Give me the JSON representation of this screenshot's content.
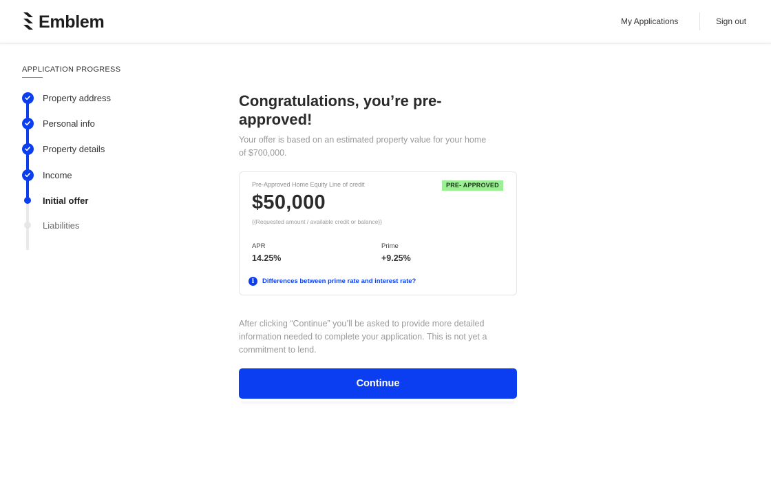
{
  "header": {
    "brand": "Emblem",
    "nav": {
      "my_applications": "My Applications",
      "sign_out": "Sign out"
    }
  },
  "sidebar": {
    "title": "APPLICATION PROGRESS",
    "steps": [
      {
        "label": "Property address",
        "state": "done"
      },
      {
        "label": "Personal info",
        "state": "done"
      },
      {
        "label": "Property details",
        "state": "done"
      },
      {
        "label": "Income",
        "state": "done"
      },
      {
        "label": "Initial offer",
        "state": "current"
      },
      {
        "label": "Liabilities",
        "state": "todo"
      }
    ]
  },
  "main": {
    "headline": "Congratulations, you’re pre-approved!",
    "subtext": "Your offer is based on an estimated property value for your home of $700,000.",
    "offer": {
      "label": "Pre-Approved Home Equity Line of credit",
      "badge": "PRE- APPROVED",
      "amount": "$50,000",
      "note": "{{Requested amount / available credit or balance}}",
      "apr_label": "APR",
      "apr_value": "14.25%",
      "prime_label": "Prime",
      "prime_value": "+9.25%",
      "info_link": "Differences between prime rate and interest rate?"
    },
    "disclaimer": "After clicking “Continue” you’ll be asked to provide more detailed information needed to complete your application. This is not yet a commitment to lend.",
    "continue_label": "Continue"
  },
  "colors": {
    "accent": "#0a3ef0",
    "badge_bg": "#9cef94",
    "muted_text": "#9a9a9a"
  },
  "icons": {
    "logo": "emblem-stripes-icon",
    "check": "check-icon",
    "info": "info-icon"
  }
}
